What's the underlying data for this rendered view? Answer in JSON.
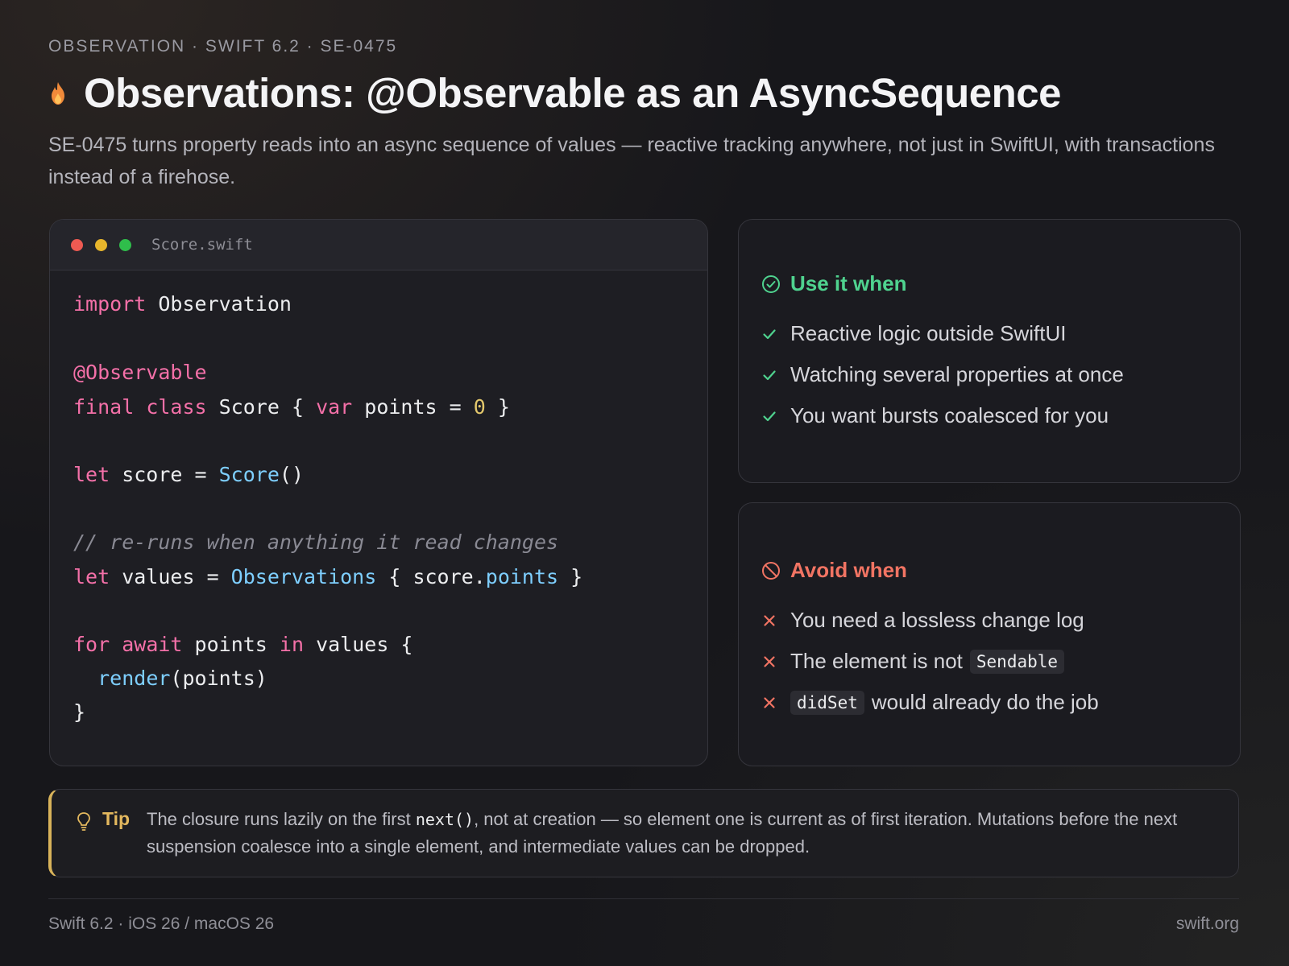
{
  "header": {
    "eyebrow": "OBSERVATION · SWIFT 6.2 · SE-0475",
    "icon": "flame-icon",
    "title": "Observations: @Observable as an AsyncSequence",
    "subtitle": "SE-0475 turns property reads into an async sequence of values — reactive tracking anywhere, not just in SwiftUI, with transactions instead of a firehose."
  },
  "code": {
    "filename": "Score.swift",
    "window_dots": [
      "#ee5a52",
      "#e8b62c",
      "#2fbe4b"
    ],
    "lines": [
      [
        {
          "t": "import",
          "k": "kw"
        },
        {
          "t": " Observation"
        }
      ],
      [
        {
          "t": "@Observable",
          "k": "kw"
        }
      ],
      [
        {
          "t": "final",
          "k": "kw"
        },
        {
          "t": " "
        },
        {
          "t": "class",
          "k": "kw"
        },
        {
          "t": " Score { "
        },
        {
          "t": "var",
          "k": "kw"
        },
        {
          "t": " points = "
        },
        {
          "t": "0",
          "k": "num"
        },
        {
          "t": " }"
        }
      ],
      [
        {
          "t": "let",
          "k": "kw"
        },
        {
          "t": " score = "
        },
        {
          "t": "Score",
          "k": "ty"
        },
        {
          "t": "()"
        }
      ],
      [
        {
          "t": "// re-runs when anything it read changes",
          "k": "cm"
        }
      ],
      [
        {
          "t": "let",
          "k": "kw"
        },
        {
          "t": " values = "
        },
        {
          "t": "Observations",
          "k": "ty"
        },
        {
          "t": " { score."
        },
        {
          "t": "points",
          "k": "ty"
        },
        {
          "t": " }"
        }
      ],
      [
        {
          "t": "for",
          "k": "kw"
        },
        {
          "t": " "
        },
        {
          "t": "await",
          "k": "kw"
        },
        {
          "t": " points "
        },
        {
          "t": "in",
          "k": "kw"
        },
        {
          "t": " values {"
        }
      ],
      [
        {
          "t": "  "
        },
        {
          "t": "render",
          "k": "ty"
        },
        {
          "t": "(points)"
        }
      ],
      [
        {
          "t": "}"
        }
      ]
    ]
  },
  "use_panel": {
    "heading": "Use it when",
    "icon": "check-circle-icon",
    "color": "#4fd38f",
    "items": [
      {
        "text": "Reactive logic outside SwiftUI"
      },
      {
        "text": "Watching several properties at once"
      },
      {
        "text": "You want bursts coalesced for you"
      }
    ]
  },
  "avoid_panel": {
    "heading": "Avoid when",
    "icon": "prohibited-icon",
    "color": "#f27463",
    "items": [
      {
        "text": "You need a lossless change log"
      },
      {
        "text": "The element is not",
        "code": "Sendable"
      },
      {
        "code": "didSet",
        "text": "would already do the job"
      }
    ]
  },
  "tip": {
    "icon": "lightbulb-icon",
    "label": "Tip",
    "text_before": "The closure runs lazily on the first ",
    "code": "next()",
    "text_after": ", not at creation — so element one is current as of first iteration. Mutations before the next suspension coalesce into a single element, and intermediate values can be dropped.",
    "accent": "#d8b35a"
  },
  "footer": {
    "left": "Swift 6.2 · iOS 26 / macOS 26",
    "right": "swift.org"
  }
}
